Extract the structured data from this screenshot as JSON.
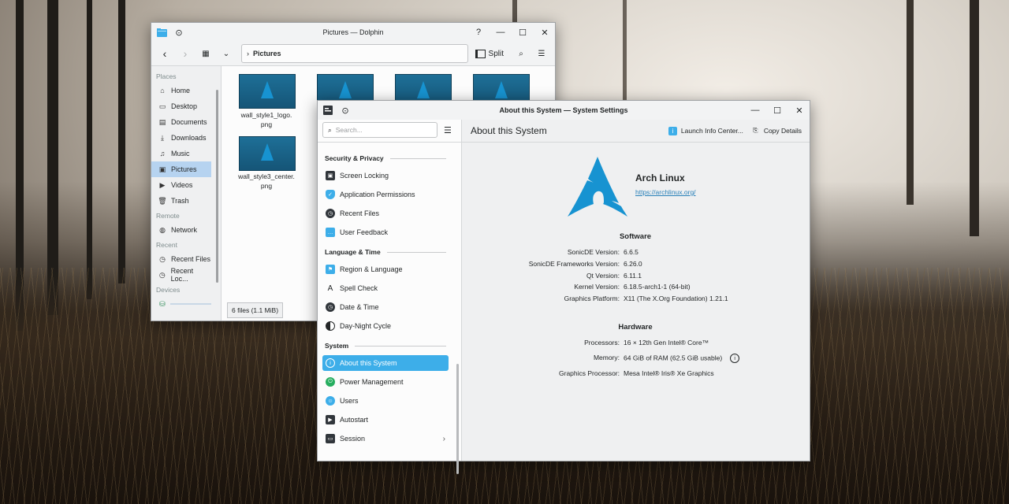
{
  "dolphin": {
    "title": "Pictures — Dolphin",
    "breadcrumb": "Pictures",
    "split_label": "Split",
    "places_heading": "Places",
    "places": [
      {
        "label": "Home",
        "icon": "home-icon"
      },
      {
        "label": "Desktop",
        "icon": "desktop-icon"
      },
      {
        "label": "Documents",
        "icon": "documents-icon"
      },
      {
        "label": "Downloads",
        "icon": "downloads-icon"
      },
      {
        "label": "Music",
        "icon": "music-icon"
      },
      {
        "label": "Pictures",
        "icon": "pictures-icon"
      },
      {
        "label": "Videos",
        "icon": "videos-icon"
      },
      {
        "label": "Trash",
        "icon": "trash-icon"
      }
    ],
    "remote_heading": "Remote",
    "remote": [
      {
        "label": "Network",
        "icon": "network-icon"
      }
    ],
    "recent_heading": "Recent",
    "recent": [
      {
        "label": "Recent Files",
        "icon": "recent-files-icon"
      },
      {
        "label": "Recent Loc...",
        "icon": "recent-locations-icon"
      }
    ],
    "devices_heading": "Devices",
    "files": [
      {
        "name": "wall_style1_logo.\npng"
      },
      {
        "name": ""
      },
      {
        "name": ""
      },
      {
        "name": ""
      },
      {
        "name": "wall_style3_center.\npng"
      }
    ],
    "status": "6 files (1.1 MiB)"
  },
  "settings": {
    "title": "About this System — System Settings",
    "search_placeholder": "Search...",
    "page_title": "About this System",
    "launch_info": "Launch Info Center...",
    "copy_details": "Copy Details",
    "sections": {
      "security": "Security & Privacy",
      "language": "Language & Time",
      "system": "System"
    },
    "items": {
      "screen_locking": "Screen Locking",
      "app_permissions": "Application Permissions",
      "recent_files": "Recent Files",
      "user_feedback": "User Feedback",
      "region_language": "Region & Language",
      "spell_check": "Spell Check",
      "date_time": "Date & Time",
      "day_night": "Day-Night Cycle",
      "about": "About this System",
      "power": "Power Management",
      "users": "Users",
      "autostart": "Autostart",
      "session": "Session"
    },
    "distro_name": "Arch Linux",
    "distro_url": "https://archlinux.org/",
    "software_heading": "Software",
    "software": [
      {
        "k": "SonicDE Version:",
        "v": "6.6.5"
      },
      {
        "k": "SonicDE Frameworks Version:",
        "v": "6.26.0"
      },
      {
        "k": "Qt Version:",
        "v": "6.11.1"
      },
      {
        "k": "Kernel Version:",
        "v": "6.18.5-arch1-1 (64-bit)"
      },
      {
        "k": "Graphics Platform:",
        "v": "X11 (The X.Org Foundation) 1.21.1"
      }
    ],
    "hardware_heading": "Hardware",
    "hardware": [
      {
        "k": "Processors:",
        "v": "16 × 12th Gen Intel® Core™"
      },
      {
        "k": "Memory:",
        "v": "64 GiB of RAM (62.5 GiB usable)"
      },
      {
        "k": "Graphics Processor:",
        "v": "Mesa Intel® Iris® Xe Graphics"
      }
    ],
    "accent_color": "#3daee9",
    "arch_blue": "#1793d1"
  }
}
